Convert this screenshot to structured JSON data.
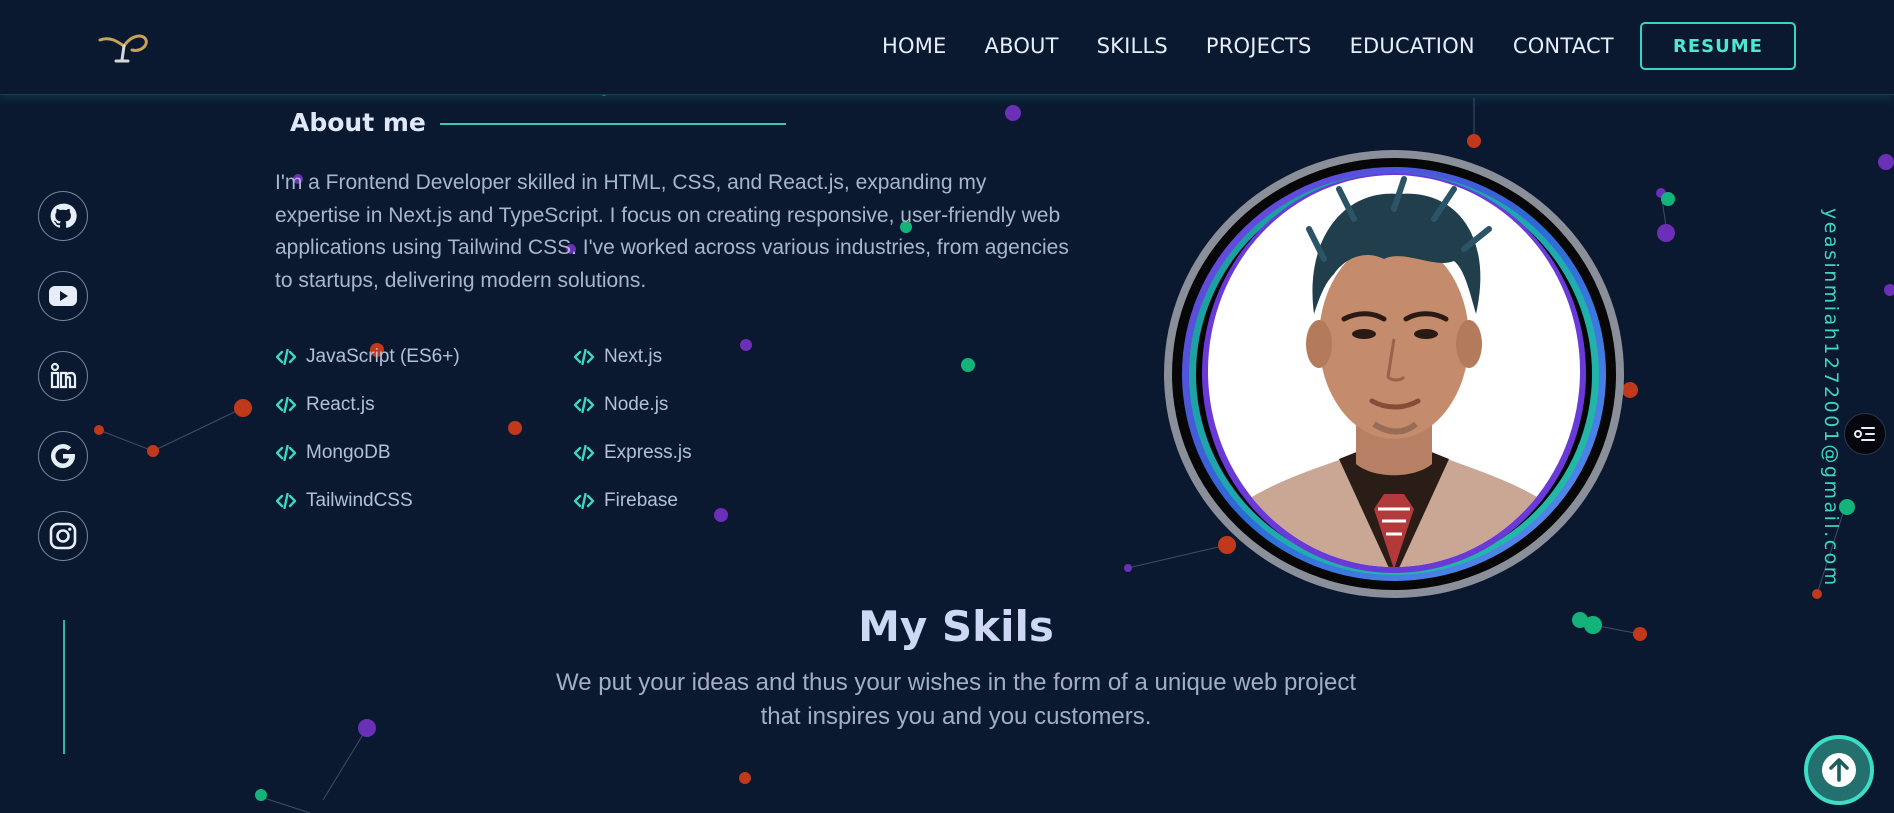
{
  "header": {
    "logo": "Y",
    "nav": [
      "HOME",
      "ABOUT",
      "SKILLS",
      "PROJECTS",
      "EDUCATION",
      "CONTACT"
    ],
    "resume_label": "RESUME"
  },
  "social": [
    "github-icon",
    "youtube-icon",
    "linkedin-icon",
    "google-icon",
    "instagram-icon"
  ],
  "about": {
    "title": "About me",
    "text": "I'm a Frontend Developer skilled in HTML, CSS, and React.js, expanding my expertise in Next.js and TypeScript. I focus on creating responsive, user-friendly web applications using Tailwind CSS. I've worked across various industries, from agencies to startups, delivering modern solutions.",
    "skills": [
      "JavaScript (ES6+)",
      "Next.js",
      "React.js",
      "Node.js",
      "MongoDB",
      "Express.js",
      "TailwindCSS",
      "Firebase"
    ]
  },
  "email": "yeasinmiah1272001@gmail.com",
  "my_skills": {
    "title": "My Skils",
    "subtitle_line1": "We put your ideas and thus your wishes in the form of a unique web project",
    "subtitle_line2": "that inspires you and you customers."
  },
  "colors": {
    "background": "#0b1930",
    "accent": "#3ddcc5",
    "particle_purple": "#6b2fb8",
    "particle_orange": "#c0391b",
    "particle_green": "#14b37a"
  }
}
